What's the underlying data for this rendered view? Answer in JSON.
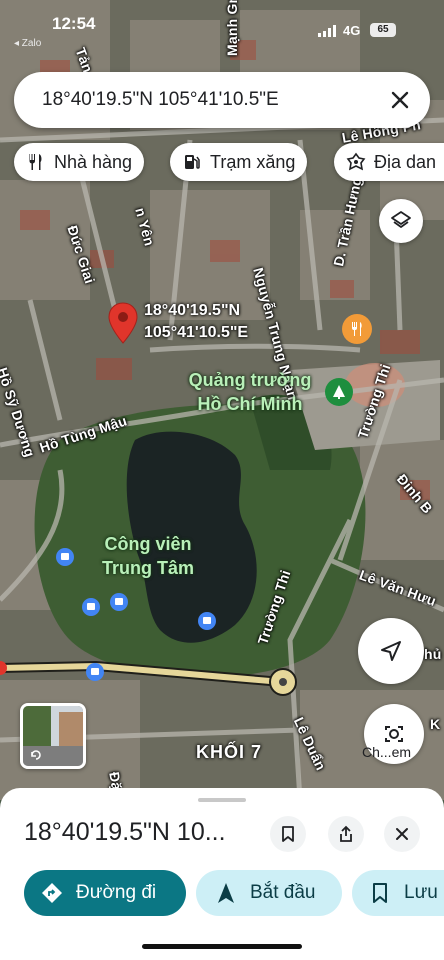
{
  "status_bar": {
    "time": "12:54",
    "back_app": "◂ Zalo",
    "network": "4G",
    "battery": "65"
  },
  "search": {
    "value": "18°40'19.5\"N 105°41'10.5\"E"
  },
  "chips": [
    {
      "label": "Nhà hàng",
      "icon": "restaurant-icon"
    },
    {
      "label": "Trạm xăng",
      "icon": "gas-station-icon"
    },
    {
      "label": "Địa dan",
      "icon": "landmark-icon"
    }
  ],
  "map": {
    "pin_label_lat": "18°40'19.5\"N",
    "pin_label_lng": "105°41'10.5\"E",
    "streets": [
      "Tản Cư",
      "Mạnh Gmen",
      "Lê Hồng Ph",
      "Đức Giai",
      "n Yên",
      "Nguyễn Trung Ngạn",
      "D. Trần Hưng Lực",
      "Hồ Sỹ Dương",
      "Hồ Tùng Mậu",
      "Trường Thi",
      "Đinh B",
      "Lê Văn Hưu",
      "Trường Thi",
      "Lê Duẩn",
      "Đặn",
      "K",
      "hủ"
    ],
    "pois": [
      "Quảng trường Hồ Chí Minh",
      "Công viên Trung Tâm"
    ],
    "area_label": "KHỐI 7"
  },
  "lens_label": "Ch...em",
  "sheet": {
    "title": "18°40'19.5\"N 10...",
    "buttons": {
      "directions": "Đường đi",
      "start": "Bắt đầu",
      "save": "Lưu"
    }
  },
  "colors": {
    "primary": "#0b7784",
    "primary_light": "#cdeff6",
    "pin_red": "#e0352b"
  }
}
